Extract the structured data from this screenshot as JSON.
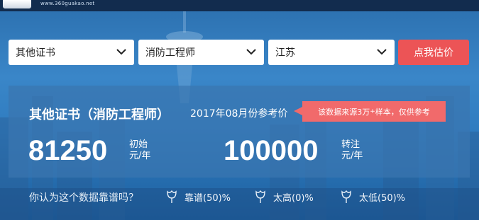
{
  "header": {
    "site_url": "www.360guakao.net"
  },
  "selectors": {
    "category": "其他证书",
    "certificate": "消防工程师",
    "region": "江苏",
    "estimate_button": "点我估价"
  },
  "result": {
    "title": "其他证书（消防工程师）",
    "period": "2017年08月份参考价",
    "source_note_prefix": "该数据来源3万",
    "source_note_sup": "+",
    "source_note_suffix": "样本，仅供参考",
    "initial_value": "81250",
    "initial_label_line1": "初始",
    "initial_label_line2": "元/年",
    "renewal_value": "100000",
    "renewal_label_line1": "转注",
    "renewal_label_line2": "元/年"
  },
  "feedback": {
    "question": "你认为这个数据靠谱吗？",
    "options": [
      {
        "label": "靠谱(50)%"
      },
      {
        "label": "太高(0)%"
      },
      {
        "label": "太低(50)%"
      }
    ]
  },
  "colors": {
    "accent_red": "#ec5456",
    "tag_red": "#f16a6b",
    "header_bg": "#122c4e"
  }
}
